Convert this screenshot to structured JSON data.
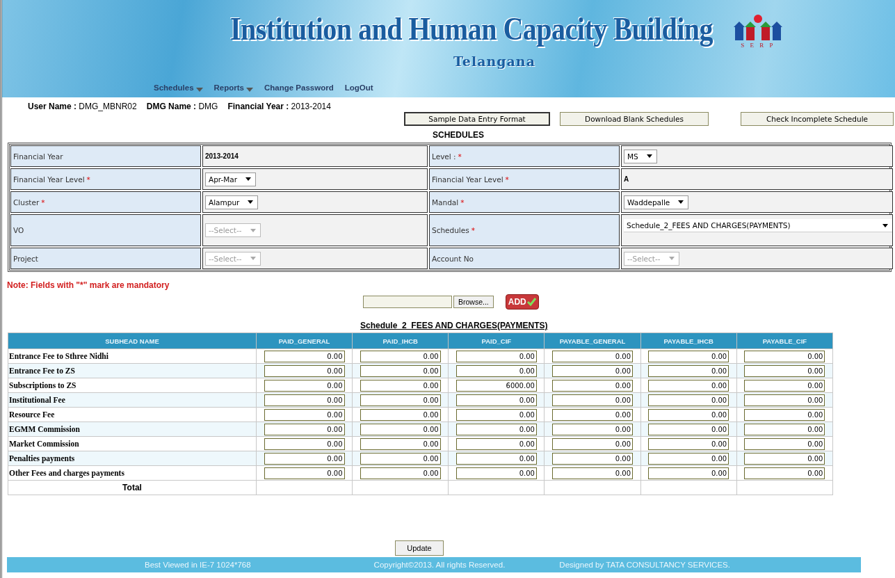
{
  "header": {
    "title": "Institution and Human Capacity Building",
    "subtitle": "Telangana",
    "logo_text": "S E R P"
  },
  "menu": [
    {
      "label": "Schedules",
      "dropdown": true
    },
    {
      "label": "Reports",
      "dropdown": true
    },
    {
      "label": "Change Password",
      "dropdown": false
    },
    {
      "label": "LogOut",
      "dropdown": false
    }
  ],
  "user_info": [
    {
      "label": "User Name :",
      "value": "DMG_MBNR02"
    },
    {
      "label": "DMG Name :",
      "value": "DMG"
    },
    {
      "label": "Financial Year :",
      "value": "2013-2014"
    }
  ],
  "action_buttons": [
    {
      "label": "Sample Data Entry Format",
      "focused": true
    },
    {
      "label": "Download Blank Schedules",
      "focused": false
    },
    {
      "label": "Check Incomplete Schedule",
      "focused": false
    }
  ],
  "section_title": "SCHEDULES",
  "form_rows": [
    [
      {
        "label": "Financial Year",
        "kind": "text",
        "value": "2013-2014"
      },
      {
        "label": "Level :",
        "required_mark": "*",
        "kind": "select",
        "value": "MS",
        "disabled": false
      }
    ],
    [
      {
        "label": "Financial Year Level",
        "required_mark": "*",
        "kind": "select",
        "value": "Apr-Mar",
        "disabled": false
      },
      {
        "label": "Financial Year Level",
        "required_mark": "*",
        "kind": "text",
        "value": "A"
      }
    ],
    [
      {
        "label": "Cluster",
        "required_mark": "*",
        "kind": "select",
        "value": "Alampur",
        "disabled": false
      },
      {
        "label": "Mandal",
        "required_mark": "*",
        "kind": "select",
        "value": "Waddepalle",
        "disabled": false
      }
    ],
    [
      {
        "label": "VO",
        "kind": "select",
        "value": "--Select--",
        "disabled": true
      },
      {
        "label": "Schedules",
        "required_mark": "*",
        "kind": "wide-select",
        "value": "Schedule_2_FEES AND CHARGES(PAYMENTS)"
      }
    ],
    [
      {
        "label": "Project",
        "kind": "select",
        "value": "--Select--",
        "disabled": true
      },
      {
        "label": "Account No",
        "kind": "select",
        "value": "--Select--",
        "disabled": true
      }
    ]
  ],
  "note": "Note: Fields with \"*\" mark are mandatory",
  "upload": {
    "browse_label": "Browse...",
    "add_label": "ADD"
  },
  "table": {
    "title": "Schedule_2_FEES AND CHARGES(PAYMENTS)",
    "columns": [
      "SUBHEAD NAME",
      "PAID_GENERAL",
      "PAID_IHCB",
      "PAID_CIF",
      "PAYABLE_GENERAL",
      "PAYABLE_IHCB",
      "PAYABLE_CIF"
    ],
    "rows": [
      {
        "name": "Entrance Fee to Sthree Nidhi",
        "values": [
          "0.00",
          "0.00",
          "0.00",
          "0.00",
          "0.00",
          "0.00"
        ]
      },
      {
        "name": "Entrance Fee to ZS",
        "values": [
          "0.00",
          "0.00",
          "0.00",
          "0.00",
          "0.00",
          "0.00"
        ]
      },
      {
        "name": "Subscriptions to ZS",
        "values": [
          "0.00",
          "0.00",
          "6000.00",
          "0.00",
          "0.00",
          "0.00"
        ]
      },
      {
        "name": "Institutional Fee",
        "values": [
          "0.00",
          "0.00",
          "0.00",
          "0.00",
          "0.00",
          "0.00"
        ]
      },
      {
        "name": "Resource Fee",
        "values": [
          "0.00",
          "0.00",
          "0.00",
          "0.00",
          "0.00",
          "0.00"
        ]
      },
      {
        "name": "EGMM Commission",
        "values": [
          "0.00",
          "0.00",
          "0.00",
          "0.00",
          "0.00",
          "0.00"
        ]
      },
      {
        "name": "Market Commission",
        "values": [
          "0.00",
          "0.00",
          "0.00",
          "0.00",
          "0.00",
          "0.00"
        ]
      },
      {
        "name": "Penalties payments",
        "values": [
          "0.00",
          "0.00",
          "0.00",
          "0.00",
          "0.00",
          "0.00"
        ]
      },
      {
        "name": "Other Fees and charges payments",
        "values": [
          "0.00",
          "0.00",
          "0.00",
          "0.00",
          "0.00",
          "0.00"
        ]
      }
    ],
    "total_label": "Total"
  },
  "update_label": "Update",
  "footer": [
    "Best Viewed in IE-7 1024*768",
    "Copyright©2013. All rights Reserved.",
    "Designed by TATA CONSULTANCY SERVICES."
  ]
}
